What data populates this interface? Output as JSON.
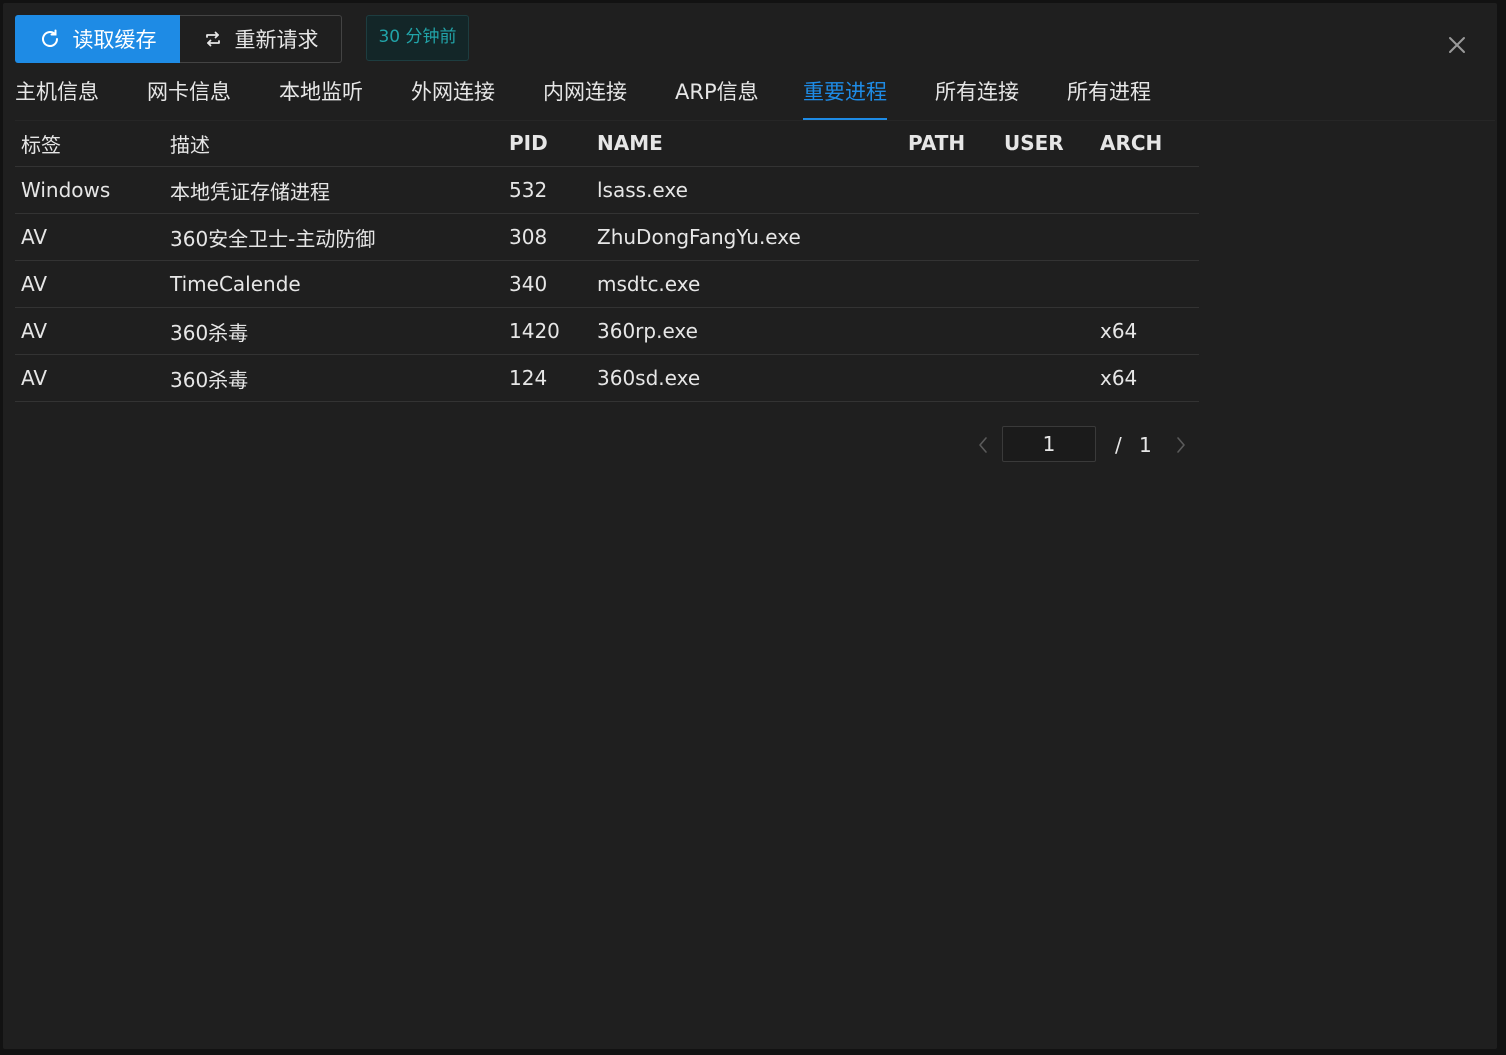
{
  "toolbar": {
    "read_cache_label": "读取缓存",
    "rerequest_label": "重新请求",
    "time_badge": "30 分钟前"
  },
  "tabs": [
    {
      "label": "主机信息"
    },
    {
      "label": "网卡信息"
    },
    {
      "label": "本地监听"
    },
    {
      "label": "外网连接"
    },
    {
      "label": "内网连接"
    },
    {
      "label": "ARP信息"
    },
    {
      "label": "重要进程",
      "active": true
    },
    {
      "label": "所有连接"
    },
    {
      "label": "所有进程"
    }
  ],
  "table": {
    "columns": [
      "标签",
      "描述",
      "PID",
      "NAME",
      "PATH",
      "USER",
      "ARCH"
    ],
    "rows": [
      [
        "Windows",
        "本地凭证存储进程",
        "532",
        "lsass.exe",
        "",
        "",
        ""
      ],
      [
        "AV",
        "360安全卫士-主动防御",
        "308",
        "ZhuDongFangYu.exe",
        "",
        "",
        ""
      ],
      [
        "AV",
        "TimeCalende",
        "340",
        "msdtc.exe",
        "",
        "",
        ""
      ],
      [
        "AV",
        "360杀毒",
        "1420",
        "360rp.exe",
        "",
        "",
        "x64"
      ],
      [
        "AV",
        "360杀毒",
        "124",
        "360sd.exe",
        "",
        "",
        "x64"
      ]
    ]
  },
  "pagination": {
    "current": "1",
    "separator": "/",
    "total": "1"
  },
  "colors": {
    "accent": "#1e8be5",
    "badge_text": "#21a3a8",
    "background": "#1f1f1f"
  },
  "icons": {
    "read_cache": "refresh-icon",
    "rerequest": "swap-icon",
    "close": "close-icon",
    "prev": "chevron-left-icon",
    "next": "chevron-right-icon"
  }
}
